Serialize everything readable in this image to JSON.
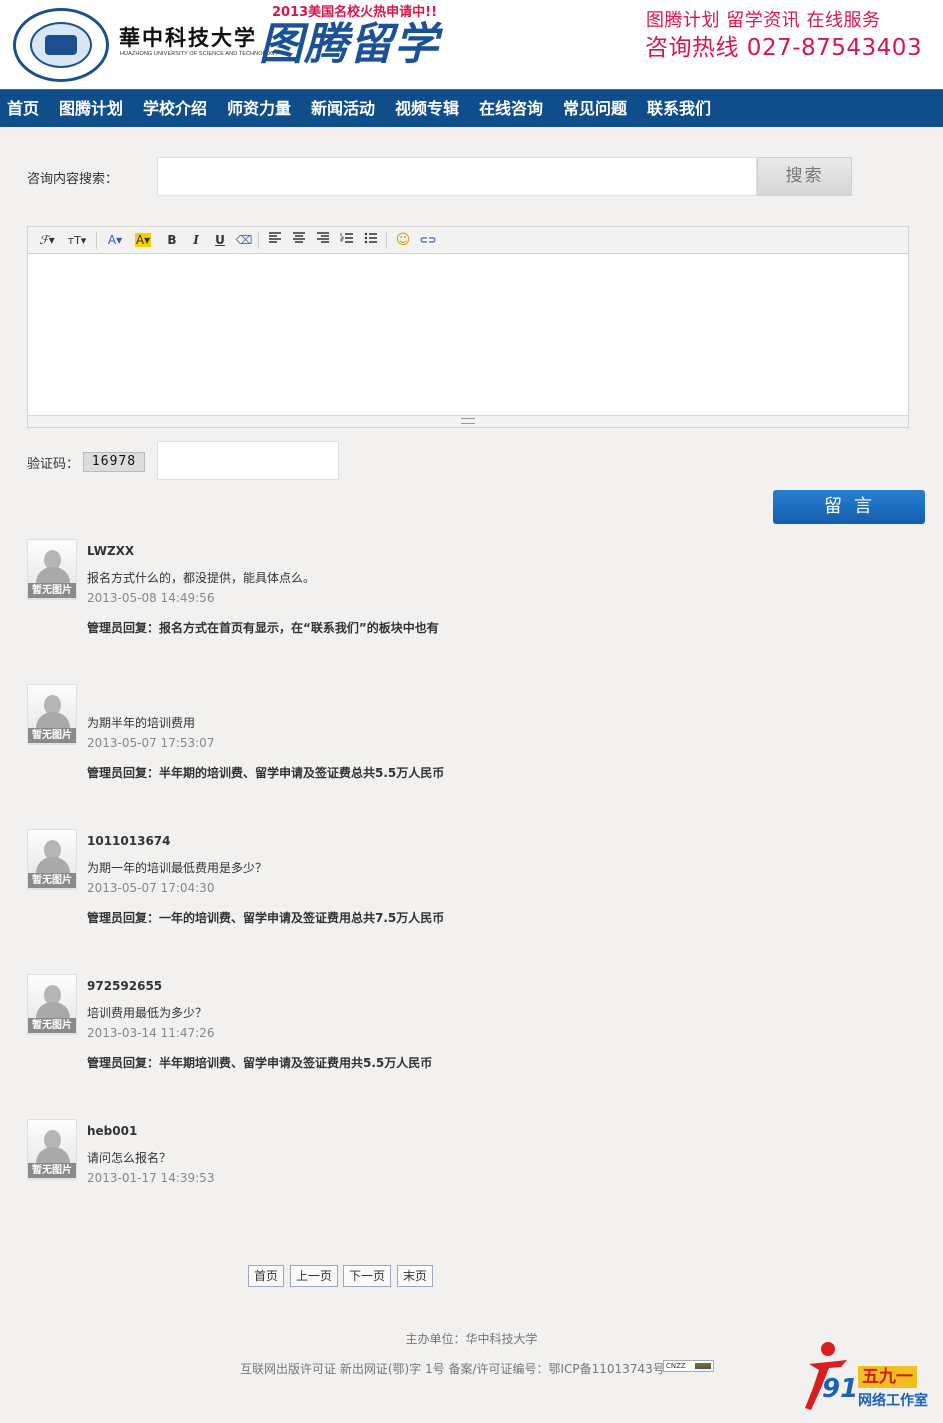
{
  "header": {
    "university_cn": "華中科技大学",
    "university_en": "HUAZHONG UNIVERSITY OF SCIENCE AND TECHNOLOGY",
    "promo": "2013美国名校火热申请中!!",
    "brand": "图腾留学",
    "slogan": "图腾计划 留学资讯 在线服务",
    "hotline": "咨询热线 027-87543403"
  },
  "nav": {
    "items": [
      {
        "label": "首页"
      },
      {
        "label": "图腾计划"
      },
      {
        "label": "学校介绍"
      },
      {
        "label": "师资力量"
      },
      {
        "label": "新闻活动"
      },
      {
        "label": "视频专辑"
      },
      {
        "label": "在线咨询"
      },
      {
        "label": "常见问题"
      },
      {
        "label": "联系我们"
      }
    ]
  },
  "search": {
    "label": "咨询内容搜索：",
    "value": "",
    "button": "搜索"
  },
  "editor": {
    "toolbar": {
      "font_family": "ℱ▾",
      "font_size": "тT▾",
      "font_color": "A▾",
      "bg_color": "A▾",
      "bold": "B",
      "italic": "I",
      "underline": "U",
      "eraser": "⌫",
      "emoticon": "☺",
      "link": "⊂⊃"
    },
    "content": ""
  },
  "captcha": {
    "label": "验证码：",
    "code": "16978",
    "value": ""
  },
  "submit": {
    "label": "留言"
  },
  "avatar_placeholder": "暂无图片",
  "messages": [
    {
      "name": "LWZXX",
      "text": "报名方式什么的，都没提供，能具体点么。",
      "time": "2013-05-08 14:49:56",
      "reply": "管理员回复：报名方式在首页有显示，在“联系我们”的板块中也有"
    },
    {
      "name": "",
      "text": " 为期半年的培训费用",
      "time": "2013-05-07 17:53:07",
      "reply": "管理员回复：半年期的培训费、留学申请及签证费总共5.5万人民币"
    },
    {
      "name": "1011013674",
      "text": "为期一年的培训最低费用是多少？",
      "time": "2013-05-07 17:04:30",
      "reply": "管理员回复：一年的培训费、留学申请及签证费用总共7.5万人民币"
    },
    {
      "name": "972592655",
      "text": "培训费用最低为多少？",
      "time": "2013-03-14 11:47:26",
      "reply": "管理员回复：半年期培训费、留学申请及签证费用共5.5万人民币"
    },
    {
      "name": "heb001",
      "text": "请问怎么报名？",
      "time": "2013-01-17 14:39:53",
      "reply": ""
    }
  ],
  "pagination": {
    "first": "首页",
    "prev": "上一页",
    "next": "下一页",
    "last": "末页"
  },
  "footer": {
    "host": "主办单位：华中科技大学",
    "license": "互联网出版许可证 新出网证(鄂)字 1号 备案/许可证编号：鄂ICP备11013743号",
    "cnzz": "CNZZ",
    "studio_number": "91",
    "studio_cn": "五九一",
    "studio_name": "网络工作室"
  },
  "colors": {
    "nav_bg": "#0f4d8b",
    "brand_blue": "#1b5296",
    "accent_red": "#d8164d",
    "submit_blue": "#1a6cc0",
    "page_bg": "#f2f1ef"
  }
}
